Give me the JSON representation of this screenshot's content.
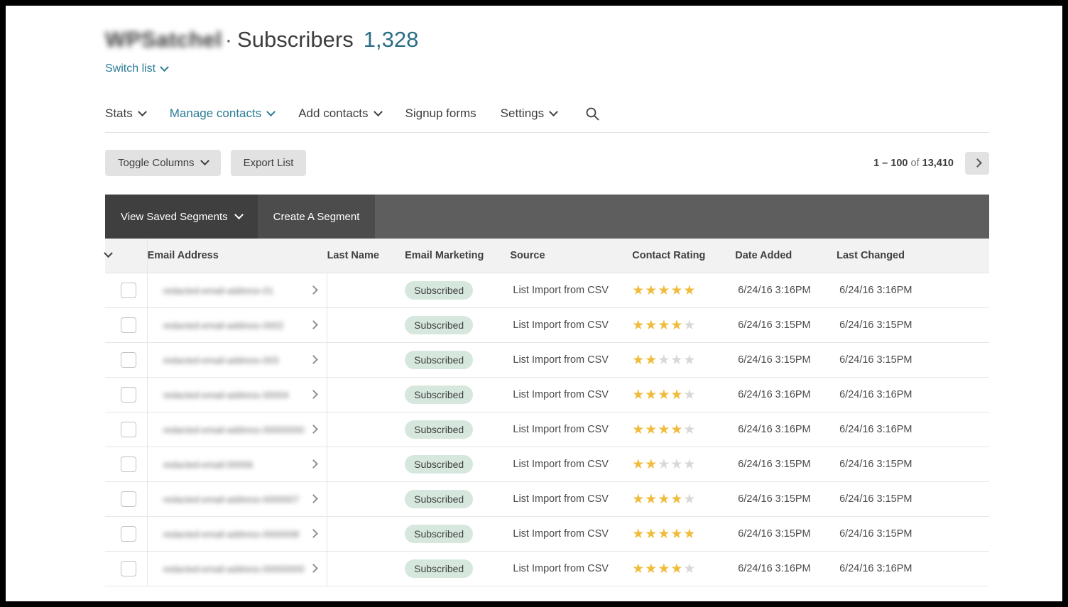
{
  "header": {
    "list_name": "WPSatchel",
    "separator": "·",
    "title": "Subscribers",
    "count": "1,328",
    "switch_list_label": "Switch list"
  },
  "nav": {
    "items": [
      {
        "label": "Stats",
        "has_caret": true,
        "active": false
      },
      {
        "label": "Manage contacts",
        "has_caret": true,
        "active": true
      },
      {
        "label": "Add contacts",
        "has_caret": true,
        "active": false
      },
      {
        "label": "Signup forms",
        "has_caret": false,
        "active": false
      },
      {
        "label": "Settings",
        "has_caret": true,
        "active": false
      }
    ],
    "search_icon": "search-icon"
  },
  "toolbar": {
    "toggle_columns_label": "Toggle Columns",
    "export_list_label": "Export List",
    "pagination": {
      "range": "1 – 100",
      "of": "of",
      "total": "13,410",
      "next_icon": "chevron-right-icon"
    }
  },
  "segment_bar": {
    "view_saved_label": "View Saved Segments",
    "create_label": "Create A Segment"
  },
  "table": {
    "columns": [
      "Email Address",
      "Last Name",
      "Email Marketing",
      "Source",
      "Contact Rating",
      "Date Added",
      "Last Changed"
    ],
    "rows": [
      {
        "email": "redacted-email-address-01",
        "last_name": "",
        "marketing": "Subscribed",
        "source": "List Import from CSV",
        "rating": 5,
        "date_added": "6/24/16 3:16PM",
        "last_changed": "6/24/16 3:16PM"
      },
      {
        "email": "redacted-email-address-0002",
        "last_name": "",
        "marketing": "Subscribed",
        "source": "List Import from CSV",
        "rating": 4,
        "date_added": "6/24/16 3:15PM",
        "last_changed": "6/24/16 3:15PM"
      },
      {
        "email": "redacted-email-address-003",
        "last_name": "",
        "marketing": "Subscribed",
        "source": "List Import from CSV",
        "rating": 2,
        "date_added": "6/24/16 3:15PM",
        "last_changed": "6/24/16 3:15PM"
      },
      {
        "email": "redacted-email-address-00004",
        "last_name": "",
        "marketing": "Subscribed",
        "source": "List Import from CSV",
        "rating": 4,
        "date_added": "6/24/16 3:16PM",
        "last_changed": "6/24/16 3:16PM"
      },
      {
        "email": "redacted-email-address-000000005",
        "last_name": "",
        "marketing": "Subscribed",
        "source": "List Import from CSV",
        "rating": 4,
        "date_added": "6/24/16 3:16PM",
        "last_changed": "6/24/16 3:16PM"
      },
      {
        "email": "redacted-email-00006",
        "last_name": "",
        "marketing": "Subscribed",
        "source": "List Import from CSV",
        "rating": 2,
        "date_added": "6/24/16 3:15PM",
        "last_changed": "6/24/16 3:15PM"
      },
      {
        "email": "redacted-email-address-0000007",
        "last_name": "",
        "marketing": "Subscribed",
        "source": "List Import from CSV",
        "rating": 4,
        "date_added": "6/24/16 3:15PM",
        "last_changed": "6/24/16 3:15PM"
      },
      {
        "email": "redacted-email-address-0000008",
        "last_name": "",
        "marketing": "Subscribed",
        "source": "List Import from CSV",
        "rating": 5,
        "date_added": "6/24/16 3:15PM",
        "last_changed": "6/24/16 3:15PM"
      },
      {
        "email": "redacted-email-address-00000000009",
        "last_name": "",
        "marketing": "Subscribed",
        "source": "List Import from CSV",
        "rating": 4,
        "date_added": "6/24/16 3:16PM",
        "last_changed": "6/24/16 3:16PM"
      }
    ],
    "max_rating": 5
  },
  "colors": {
    "accent_teal": "#2a7c96",
    "title_count": "#2a6d84",
    "segment_bar": "#5e5e5e",
    "segment_selected": "#3f3f3f",
    "badge_bg": "#d6e8de",
    "star_on": "#f0bc3c",
    "star_off": "#d8d8d8",
    "button_bg": "#e2e2e2"
  }
}
